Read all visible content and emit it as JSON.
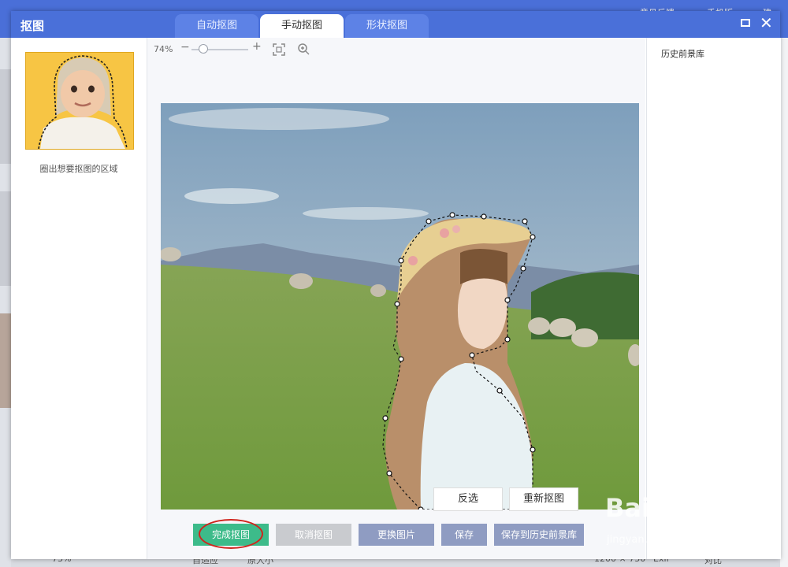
{
  "background_app": {
    "top_right_items": [
      "意见反馈",
      "手机版",
      "建"
    ],
    "bottom_zoom": "73%",
    "bottom_fit": "自适应",
    "bottom_original": "原大小",
    "bottom_size": "1200 × 750",
    "bottom_format": "Exif",
    "bottom_compare": "对比"
  },
  "dialog": {
    "title": "抠图",
    "tabs": [
      {
        "label": "自动抠图",
        "active": false
      },
      {
        "label": "手动抠图",
        "active": true
      },
      {
        "label": "形状抠图",
        "active": false
      }
    ]
  },
  "left_panel": {
    "caption": "圈出想要抠图的区域"
  },
  "canvas": {
    "zoom_level": "74%",
    "zoom_slider_fraction": 0.2,
    "invert_label": "反选",
    "redo_label": "重新抠图"
  },
  "actions": {
    "done_label": "完成抠图",
    "cancel_label": "取消抠图",
    "change_label": "更换图片",
    "save_label": "保存",
    "save_history_label": "保存到历史前景库"
  },
  "right_panel": {
    "title": "历史前景库"
  },
  "colors": {
    "accent": "#4a70d9",
    "done_button": "#3dbb8a",
    "secondary_button": "#8f9cc2",
    "disabled_button": "#c9cbcf",
    "highlight_ring": "#d0241d"
  },
  "watermark": {
    "brand": "Bai du 经验",
    "url": "jingyan.baidu.com"
  }
}
